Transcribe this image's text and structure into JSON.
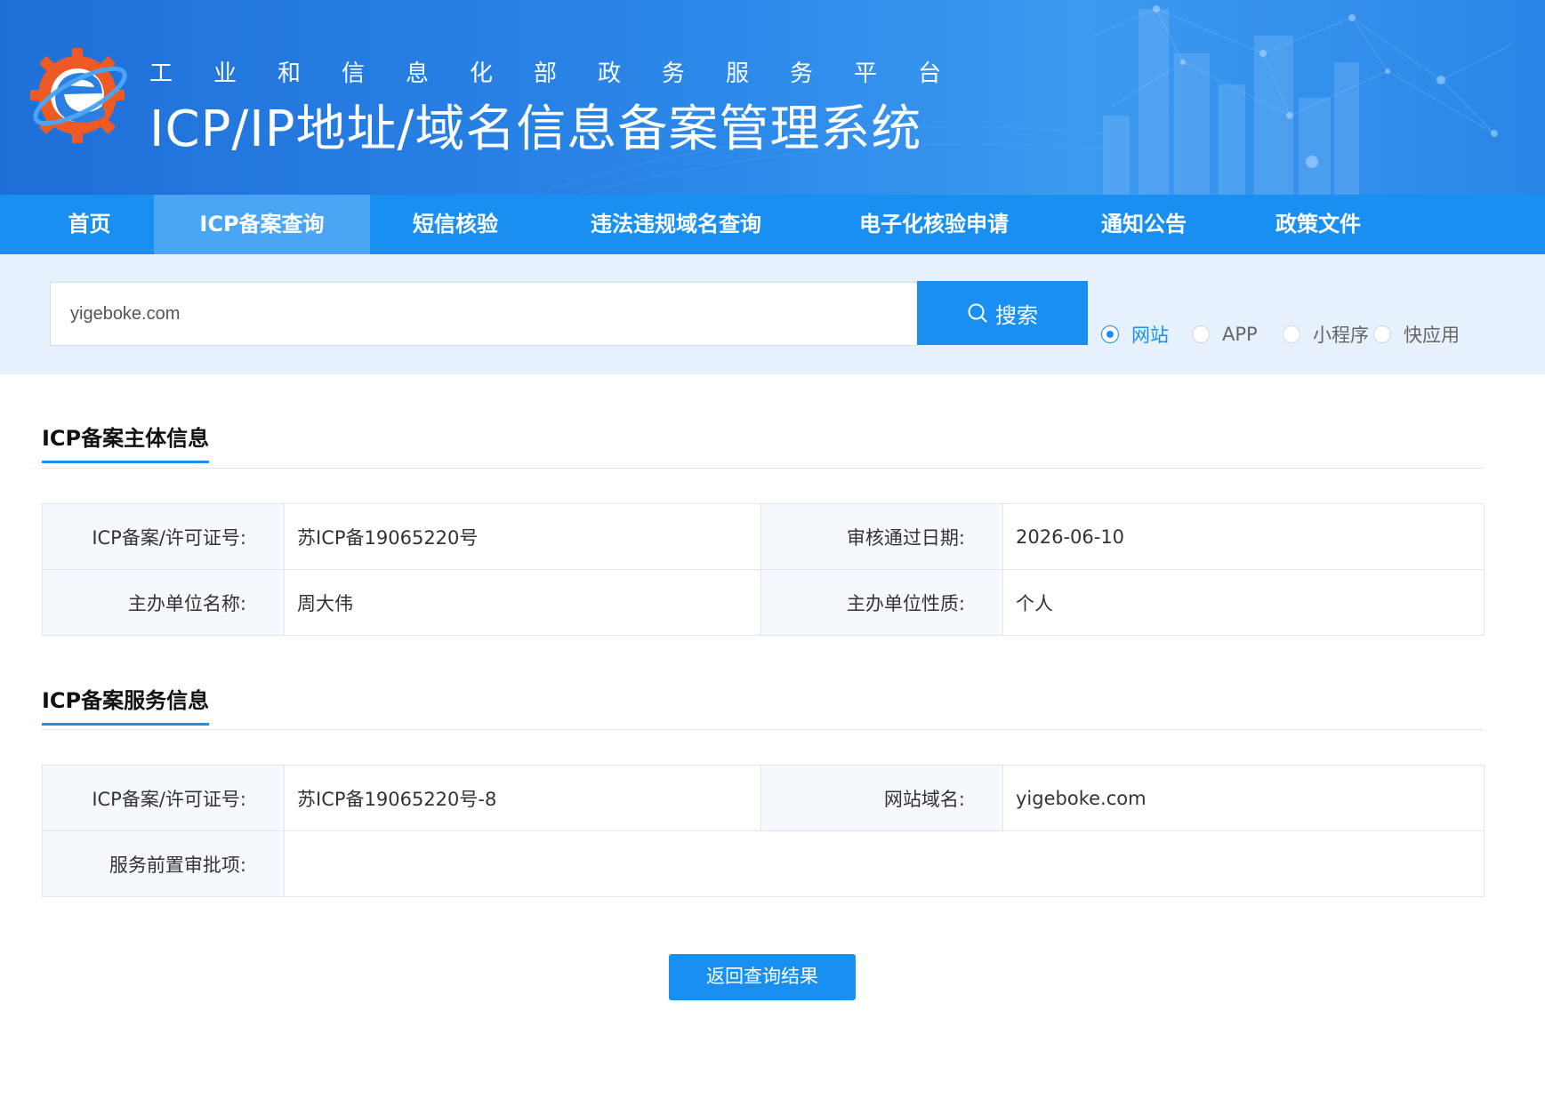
{
  "header": {
    "subtitle": "工业和信息化部政务服务平台",
    "title": "ICP/IP地址/域名信息备案管理系统"
  },
  "nav": {
    "items": [
      {
        "label": "首页",
        "active": false
      },
      {
        "label": "ICP备案查询",
        "active": true
      },
      {
        "label": "短信核验",
        "active": false
      },
      {
        "label": "违法违规域名查询",
        "active": false
      },
      {
        "label": "电子化核验申请",
        "active": false
      },
      {
        "label": "通知公告",
        "active": false
      },
      {
        "label": "政策文件",
        "active": false
      }
    ]
  },
  "search": {
    "value": "yigeboke.com",
    "button_label": "搜索",
    "types": [
      {
        "label": "网站",
        "checked": true
      },
      {
        "label": "APP",
        "checked": false
      },
      {
        "label": "小程序",
        "checked": false
      },
      {
        "label": "快应用",
        "checked": false
      }
    ]
  },
  "subject_info": {
    "title": "ICP备案主体信息",
    "license_label": "ICP备案/许可证号:",
    "license_value": "苏ICP备19065220号",
    "date_label": "审核通过日期:",
    "date_value": "2026-06-10",
    "org_name_label": "主办单位名称:",
    "org_name_value": "周大伟",
    "org_type_label": "主办单位性质:",
    "org_type_value": "个人"
  },
  "service_info": {
    "title": "ICP备案服务信息",
    "license_label": "ICP备案/许可证号:",
    "license_value": "苏ICP备19065220号-8",
    "domain_label": "网站域名:",
    "domain_value": "yigeboke.com",
    "approval_label": "服务前置审批项:",
    "approval_value": ""
  },
  "back_button_label": "返回查询结果",
  "colors": {
    "primary": "#1a8ff2",
    "nav_active": "#4aa6f5",
    "search_band": "#e7f1fb",
    "label_bg": "#f5f9fd"
  }
}
